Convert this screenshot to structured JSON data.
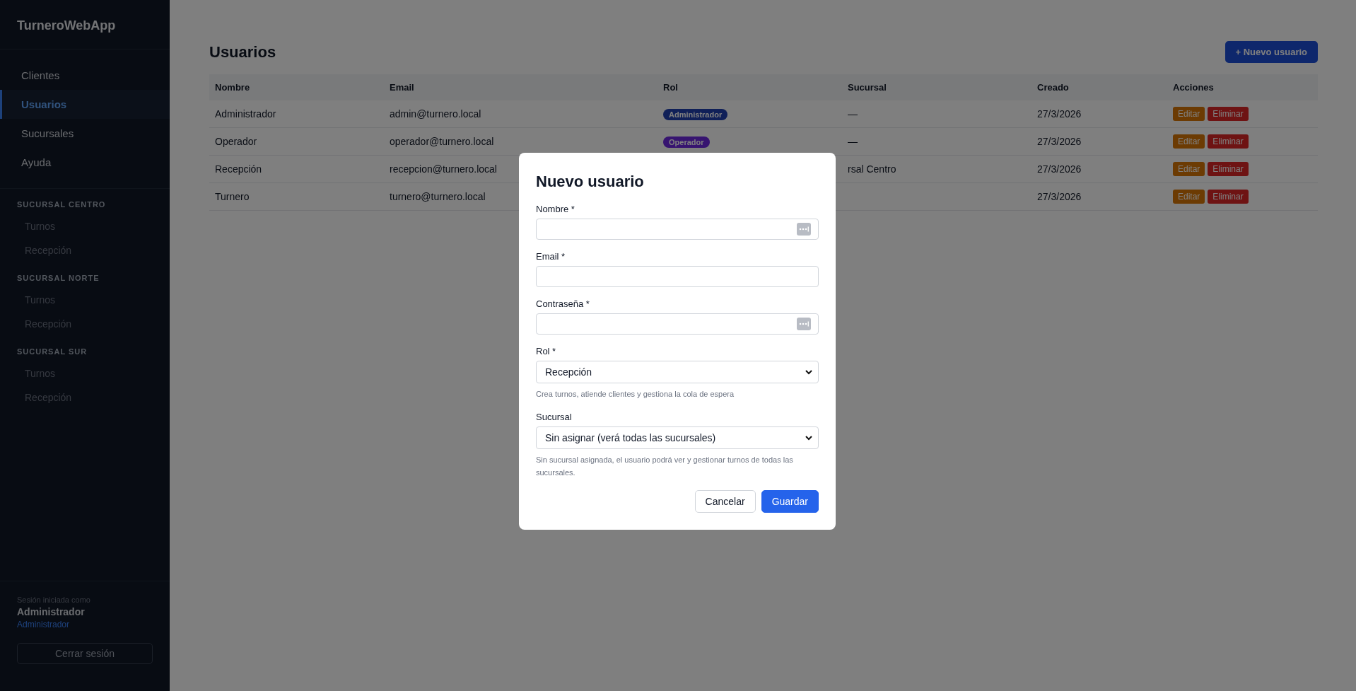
{
  "sidebar": {
    "brand": "TurneroWebApp",
    "nav": [
      {
        "label": "Clientes",
        "selected": false
      },
      {
        "label": "Usuarios",
        "selected": true
      },
      {
        "label": "Sucursales",
        "selected": false
      },
      {
        "label": "Ayuda",
        "selected": false
      }
    ],
    "sections": [
      {
        "title": "SUCURSAL CENTRO",
        "items": [
          "Turnos",
          "Recepción"
        ]
      },
      {
        "title": "SUCURSAL NORTE",
        "items": [
          "Turnos",
          "Recepción"
        ]
      },
      {
        "title": "SUCURSAL SUR",
        "items": [
          "Turnos",
          "Recepción"
        ]
      }
    ],
    "session": {
      "caption": "Sesión iniciada como",
      "user": "Administrador",
      "role": "Administrador",
      "logout": "Cerrar sesión"
    }
  },
  "page": {
    "title": "Usuarios",
    "new_button": "+ Nuevo usuario"
  },
  "table": {
    "columns": [
      "Nombre",
      "Email",
      "Rol",
      "Sucursal",
      "Creado",
      "Acciones"
    ],
    "rows": [
      {
        "name": "Administrador",
        "email": "admin@turnero.local",
        "role": {
          "label": "Administrador",
          "color": "#102058"
        },
        "branch": "—",
        "created": "27/3/2026",
        "actions": [
          "Editar",
          "Eliminar"
        ]
      },
      {
        "name": "Operador",
        "email": "operador@turnero.local",
        "role": {
          "label": "Operador",
          "color": "#371470"
        },
        "branch": "—",
        "created": "27/3/2026",
        "actions": [
          "Editar",
          "Eliminar"
        ]
      },
      {
        "name": "Recepción",
        "email": "recepcion@turnero.local",
        "branch": "rsal Centro",
        "created": "27/3/2026",
        "actions": [
          "Editar",
          "Eliminar"
        ]
      },
      {
        "name": "Turnero",
        "email": "turnero@turnero.local",
        "created": "27/3/2026",
        "actions": [
          "Editar",
          "Eliminar"
        ]
      }
    ]
  },
  "modal": {
    "title": "Nuevo usuario",
    "fields": [
      {
        "kind": "input",
        "label": "Nombre *",
        "autofill_icon": true
      },
      {
        "kind": "input",
        "label": "Email *",
        "autofill_icon": false
      },
      {
        "kind": "input",
        "label": "Contraseña *",
        "autofill_icon": true
      },
      {
        "kind": "select",
        "label": "Rol *",
        "value": "Recepción",
        "hint": "Crea turnos, atiende clientes y gestiona la cola de espera"
      },
      {
        "kind": "select",
        "label": "Sucursal",
        "value": "Sin asignar (verá todas las sucursales)",
        "hint": "Sin sucursal asignada, el usuario podrá ver y gestionar turnos de todas las sucursales."
      }
    ],
    "buttons": [
      {
        "label": "Cancelar",
        "kind": "secondary"
      },
      {
        "label": "Guardar",
        "kind": "primary"
      }
    ]
  }
}
